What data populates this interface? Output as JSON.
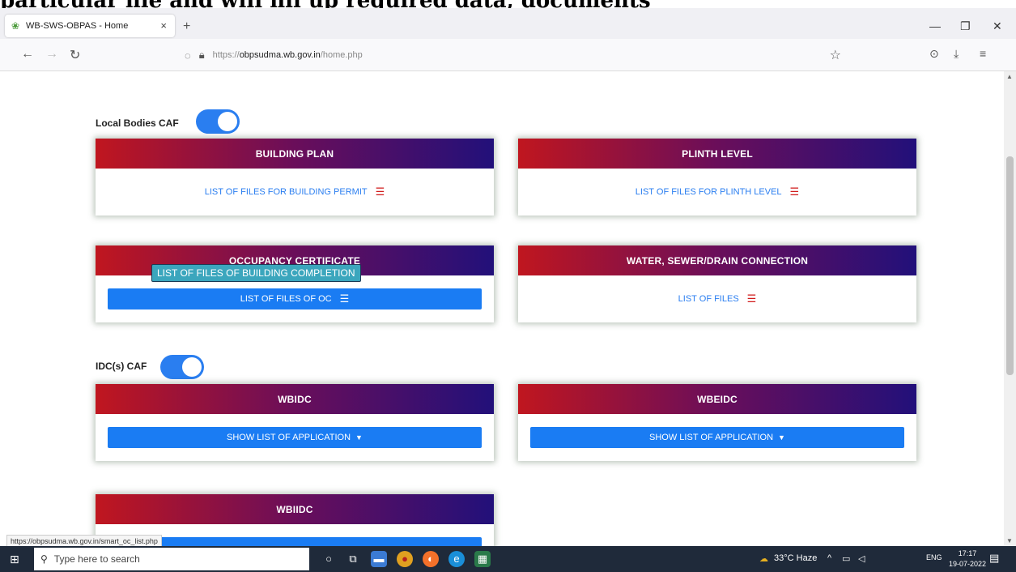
{
  "caption": "particular file and will fill up required data, documents",
  "browser": {
    "tab_title": "WB-SWS-OBPAS - Home",
    "tab_close": "×",
    "new_tab": "+",
    "url_protocol": "https://",
    "url_host": "obpsudma.wb.gov.in",
    "url_path": "/home.php",
    "status_url": "https://obpsudma.wb.gov.in/smart_oc_list.php"
  },
  "sections": {
    "local_bodies": {
      "label": "Local Bodies CAF",
      "toggle_on": true
    },
    "idc": {
      "label": "IDC(s) CAF",
      "toggle_on": true
    }
  },
  "cards": {
    "building_plan": {
      "title": "BUILDING PLAN",
      "link": "LIST OF FILES FOR BUILDING PERMIT"
    },
    "plinth_level": {
      "title": "PLINTH LEVEL",
      "link": "LIST OF FILES FOR PLINTH LEVEL"
    },
    "occupancy": {
      "title": "OCCUPANCY CERTIFICATE",
      "button": "LIST OF FILES OF OC",
      "tooltip": "LIST OF FILES OF BUILDING COMPLETION"
    },
    "water": {
      "title": "WATER, SEWER/DRAIN CONNECTION",
      "link": "LIST OF FILES"
    },
    "wbidc": {
      "title": "WBIDC",
      "button": "SHOW LIST OF APPLICATION"
    },
    "wbeidc": {
      "title": "WBEIDC",
      "button": "SHOW LIST OF APPLICATION"
    },
    "wbiidc": {
      "title": "WBIIDC"
    }
  },
  "taskbar": {
    "search_placeholder": "Type here to search",
    "weather": "33°C Haze",
    "lang": "ENG",
    "time": "17:17",
    "date": "19-07-2022"
  },
  "colors": {
    "accent_blue": "#1a7cf3",
    "header_gradient_start": "#c0161f",
    "header_gradient_end": "#22107a",
    "list_icon_red": "#d11b1b"
  }
}
